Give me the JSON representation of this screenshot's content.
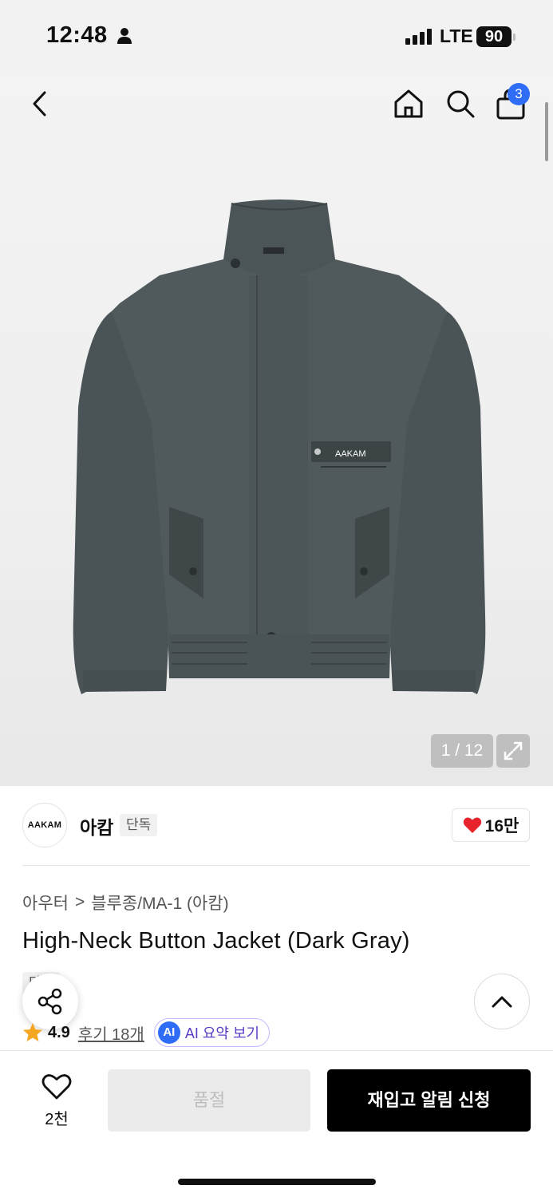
{
  "status_bar": {
    "time": "12:48",
    "network": "LTE",
    "battery": "90"
  },
  "header": {
    "cart_count": "3"
  },
  "gallery": {
    "counter": "1 / 12",
    "jacket_logo": "AAKAM"
  },
  "brand": {
    "logo_text": "AAKAM",
    "name": "아캄",
    "tag": "단독",
    "likes": "16만"
  },
  "breadcrumb": {
    "category": "아우터",
    "separator": ">",
    "subcategory": "블루종/MA-1 (아캄)"
  },
  "product": {
    "title": "High-Neck Button Jacket (Dark Gray)",
    "exclusive_tag": "단독",
    "rating": "4.9",
    "reviews": "후기 18개",
    "ai_badge": "AI",
    "ai_summary": "AI 요약 보기"
  },
  "bottom_bar": {
    "wish_count": "2천",
    "soldout_label": "품절",
    "restock_label": "재입고 알림 신청"
  },
  "colors": {
    "accent_blue": "#2f6df6",
    "heart_red": "#e8232d",
    "star_orange": "#f5a623",
    "ai_purple": "#5b3cc4"
  }
}
